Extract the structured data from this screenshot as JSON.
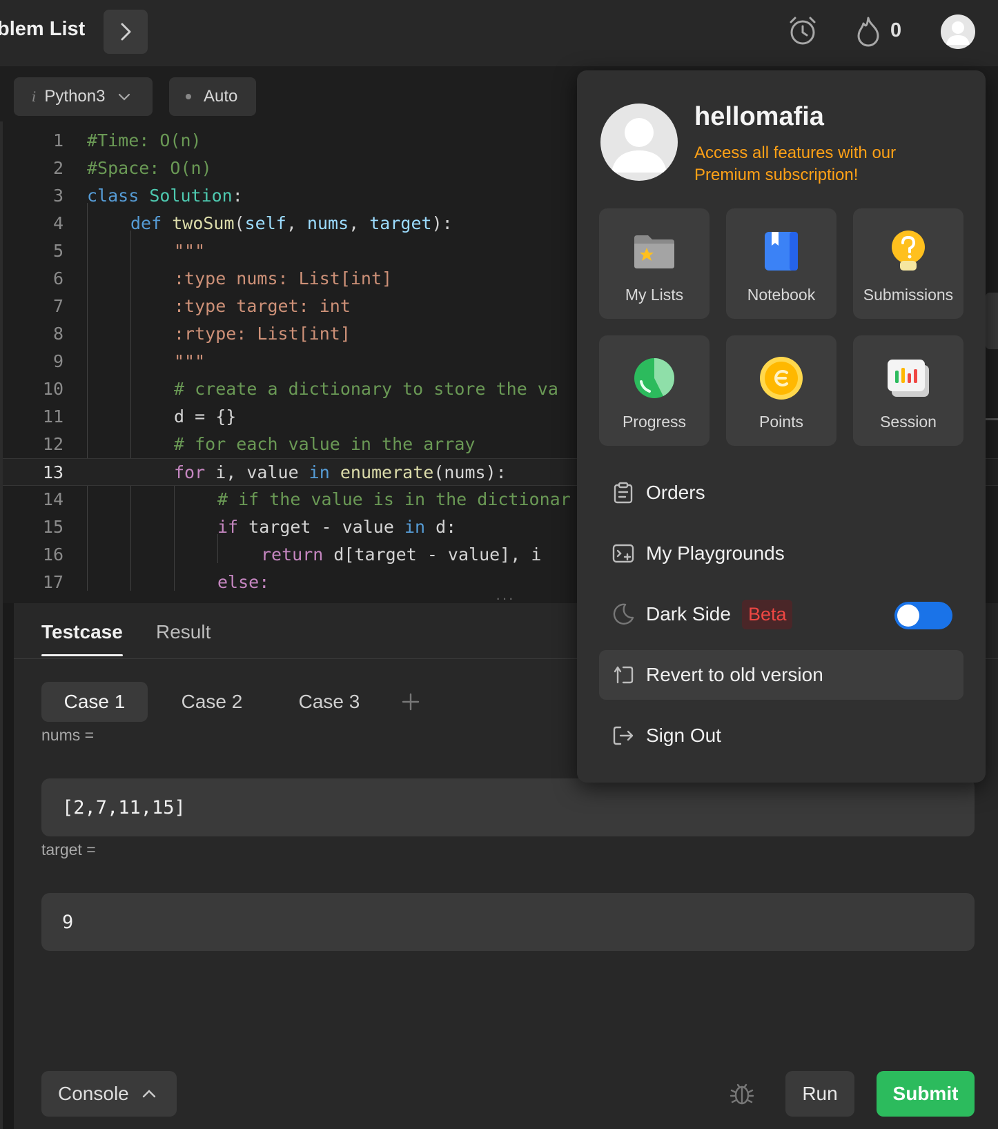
{
  "topnav": {
    "problem_list": "blem List",
    "streak_count": "0"
  },
  "editor": {
    "language": "Python3",
    "mode": "Auto",
    "lines": [
      {
        "n": "1"
      },
      {
        "n": "2"
      },
      {
        "n": "3"
      },
      {
        "n": "4"
      },
      {
        "n": "5"
      },
      {
        "n": "6"
      },
      {
        "n": "7"
      },
      {
        "n": "8"
      },
      {
        "n": "9"
      },
      {
        "n": "10"
      },
      {
        "n": "11"
      },
      {
        "n": "12"
      },
      {
        "n": "13"
      },
      {
        "n": "14"
      },
      {
        "n": "15"
      },
      {
        "n": "16"
      },
      {
        "n": "17"
      }
    ],
    "code": {
      "l1": "#Time: O(n)",
      "l2": "#Space: O(n)",
      "l3_kw": "class",
      "l3_name": "Solution",
      "l3_end": ":",
      "l4_kw": "def",
      "l4_fn": "twoSum",
      "l4_p1": "self",
      "l4_p2": "nums",
      "l4_p3": "target",
      "l4_end": "):",
      "l5": "\"\"\"",
      "l6": ":type nums: List[int]",
      "l7": ":type target: int",
      "l8": ":rtype: List[int]",
      "l9": "\"\"\"",
      "l10": "# create a dictionary to store the va",
      "l11": "d = {}",
      "l12": "# for each value in the array",
      "l13_for": "for",
      "l13_mid": " i, value ",
      "l13_in": "in",
      "l13_fn": "enumerate",
      "l13_end": "(nums):",
      "l14": "# if the value is in the dictionar",
      "l15_if": "if",
      "l15_mid": " target - value ",
      "l15_in": "in",
      "l15_end": " d:",
      "l16_ret": "return",
      "l16_end": " d[target - value], i",
      "l17": "else:"
    }
  },
  "testpanel": {
    "tabs": [
      "Testcase",
      "Result"
    ],
    "cases": [
      "Case 1",
      "Case 2",
      "Case 3"
    ],
    "fields": [
      {
        "label": "nums =",
        "value": "[2,7,11,15]"
      },
      {
        "label": "target =",
        "value": "9"
      }
    ],
    "console_label": "Console",
    "run_label": "Run",
    "submit_label": "Submit"
  },
  "menu": {
    "username": "hellomafia",
    "premium_text": "Access all features with our Premium subscription!",
    "tiles": [
      {
        "label": "My Lists",
        "icon": "folder-star-icon"
      },
      {
        "label": "Notebook",
        "icon": "notebook-icon"
      },
      {
        "label": "Submissions",
        "icon": "lightbulb-icon"
      },
      {
        "label": "Progress",
        "icon": "pie-chart-icon"
      },
      {
        "label": "Points",
        "icon": "coin-icon"
      },
      {
        "label": "Session",
        "icon": "bar-chart-icon"
      }
    ],
    "rows": {
      "orders": "Orders",
      "playgrounds": "My Playgrounds",
      "dark_side": "Dark Side",
      "beta": "Beta",
      "revert": "Revert to old version",
      "signout": "Sign Out"
    },
    "dark_side_enabled": true
  },
  "colors": {
    "accent_orange": "#ffa116",
    "submit_green": "#2cbb5d",
    "toggle_blue": "#1a73e8",
    "beta_red": "#ef4743"
  }
}
